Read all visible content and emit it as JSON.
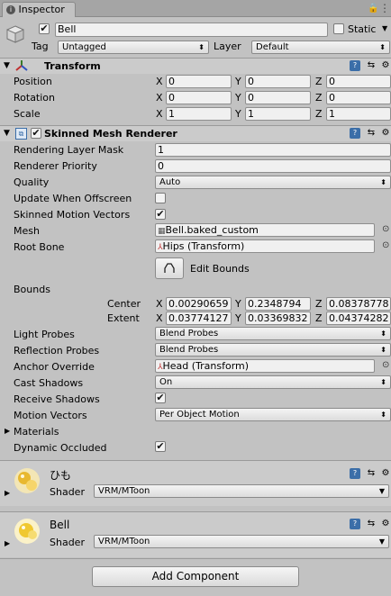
{
  "tab": {
    "title": "Inspector",
    "lock_icon": "lock-icon",
    "menu_icon": "menu-icon"
  },
  "object": {
    "name": "Bell",
    "active": true,
    "static_label": "Static",
    "static_checked": false,
    "tag_label": "Tag",
    "tag_value": "Untagged",
    "layer_label": "Layer",
    "layer_value": "Default"
  },
  "transform": {
    "title": "Transform",
    "position_label": "Position",
    "rotation_label": "Rotation",
    "scale_label": "Scale",
    "axis_x": "X",
    "axis_y": "Y",
    "axis_z": "Z",
    "position": {
      "x": "0",
      "y": "0",
      "z": "0"
    },
    "rotation": {
      "x": "0",
      "y": "0",
      "z": "0"
    },
    "scale": {
      "x": "1",
      "y": "1",
      "z": "1"
    }
  },
  "smr": {
    "title": "Skinned Mesh Renderer",
    "enabled": true,
    "rendering_layer_mask_label": "Rendering Layer Mask",
    "rendering_layer_mask_value": "1",
    "renderer_priority_label": "Renderer Priority",
    "renderer_priority_value": "0",
    "quality_label": "Quality",
    "quality_value": "Auto",
    "update_offscreen_label": "Update When Offscreen",
    "update_offscreen_checked": false,
    "skinned_motion_vectors_label": "Skinned Motion Vectors",
    "skinned_motion_vectors_checked": true,
    "mesh_label": "Mesh",
    "mesh_value": "Bell.baked_custom",
    "root_bone_label": "Root Bone",
    "root_bone_value": "Hips (Transform)",
    "edit_bounds_label": "Edit Bounds",
    "bounds_label": "Bounds",
    "center_label": "Center",
    "extent_label": "Extent",
    "center": {
      "x": "0.00290659",
      "y": "0.2348794",
      "z": "0.08378778"
    },
    "extent": {
      "x": "0.03774127",
      "y": "0.03369832",
      "z": "0.04374282"
    },
    "light_probes_label": "Light Probes",
    "light_probes_value": "Blend Probes",
    "reflection_probes_label": "Reflection Probes",
    "reflection_probes_value": "Blend Probes",
    "anchor_override_label": "Anchor Override",
    "anchor_override_value": "Head (Transform)",
    "cast_shadows_label": "Cast Shadows",
    "cast_shadows_value": "On",
    "receive_shadows_label": "Receive Shadows",
    "receive_shadows_checked": true,
    "motion_vectors_label": "Motion Vectors",
    "motion_vectors_value": "Per Object Motion",
    "materials_label": "Materials",
    "dynamic_occluded_label": "Dynamic Occluded",
    "dynamic_occluded_checked": true
  },
  "materials": [
    {
      "name": "ひも",
      "shader_label": "Shader",
      "shader_value": "VRM/MToon"
    },
    {
      "name": "Bell",
      "shader_label": "Shader",
      "shader_value": "VRM/MToon"
    }
  ],
  "add_component_label": "Add Component",
  "colors": {
    "panel_bg": "#c2c2c2",
    "header_bg": "#cbcbcb",
    "tab_accent": "#3b6ea8"
  }
}
